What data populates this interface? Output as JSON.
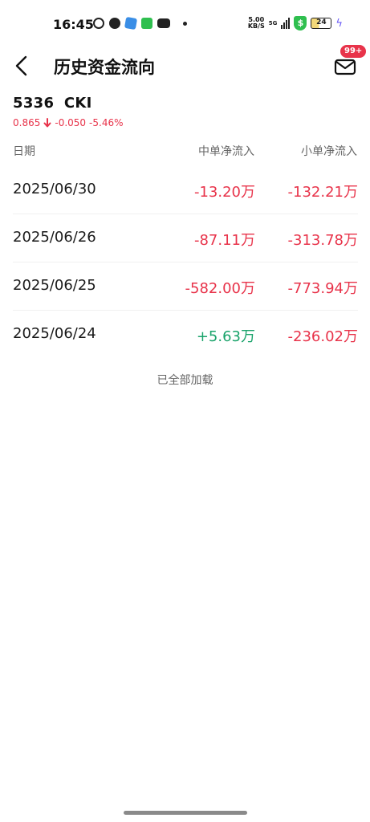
{
  "status_bar": {
    "time": "16:45",
    "net_speed_value": "5.00",
    "net_speed_unit": "KB/S",
    "network": "5G",
    "shield_glyph": "$",
    "battery": "24",
    "icons": [
      "whatsapp-icon",
      "facebook-icon",
      "app-icon",
      "messages-icon",
      "youtube-icon"
    ]
  },
  "header": {
    "title": "历史资金流向",
    "mail_badge": "99+"
  },
  "stock": {
    "code": "5336",
    "name": "CKI",
    "price": "0.865",
    "change": "-0.050",
    "change_pct": "-5.46%"
  },
  "table": {
    "columns": [
      "日期",
      "中单净流入",
      "小单净流入"
    ],
    "rows": [
      {
        "date": "2025/06/30",
        "mid": "-13.20万",
        "small": "-132.21万"
      },
      {
        "date": "2025/06/26",
        "mid": "-87.11万",
        "small": "-313.78万"
      },
      {
        "date": "2025/06/25",
        "mid": "-582.00万",
        "small": "-773.94万"
      },
      {
        "date": "2025/06/24",
        "mid": "+5.63万",
        "small": "-236.02万"
      }
    ]
  },
  "footer": {
    "loaded_text": "已全部加载"
  },
  "colors": {
    "negative": "#e8334a",
    "positive": "#1aa36b"
  }
}
